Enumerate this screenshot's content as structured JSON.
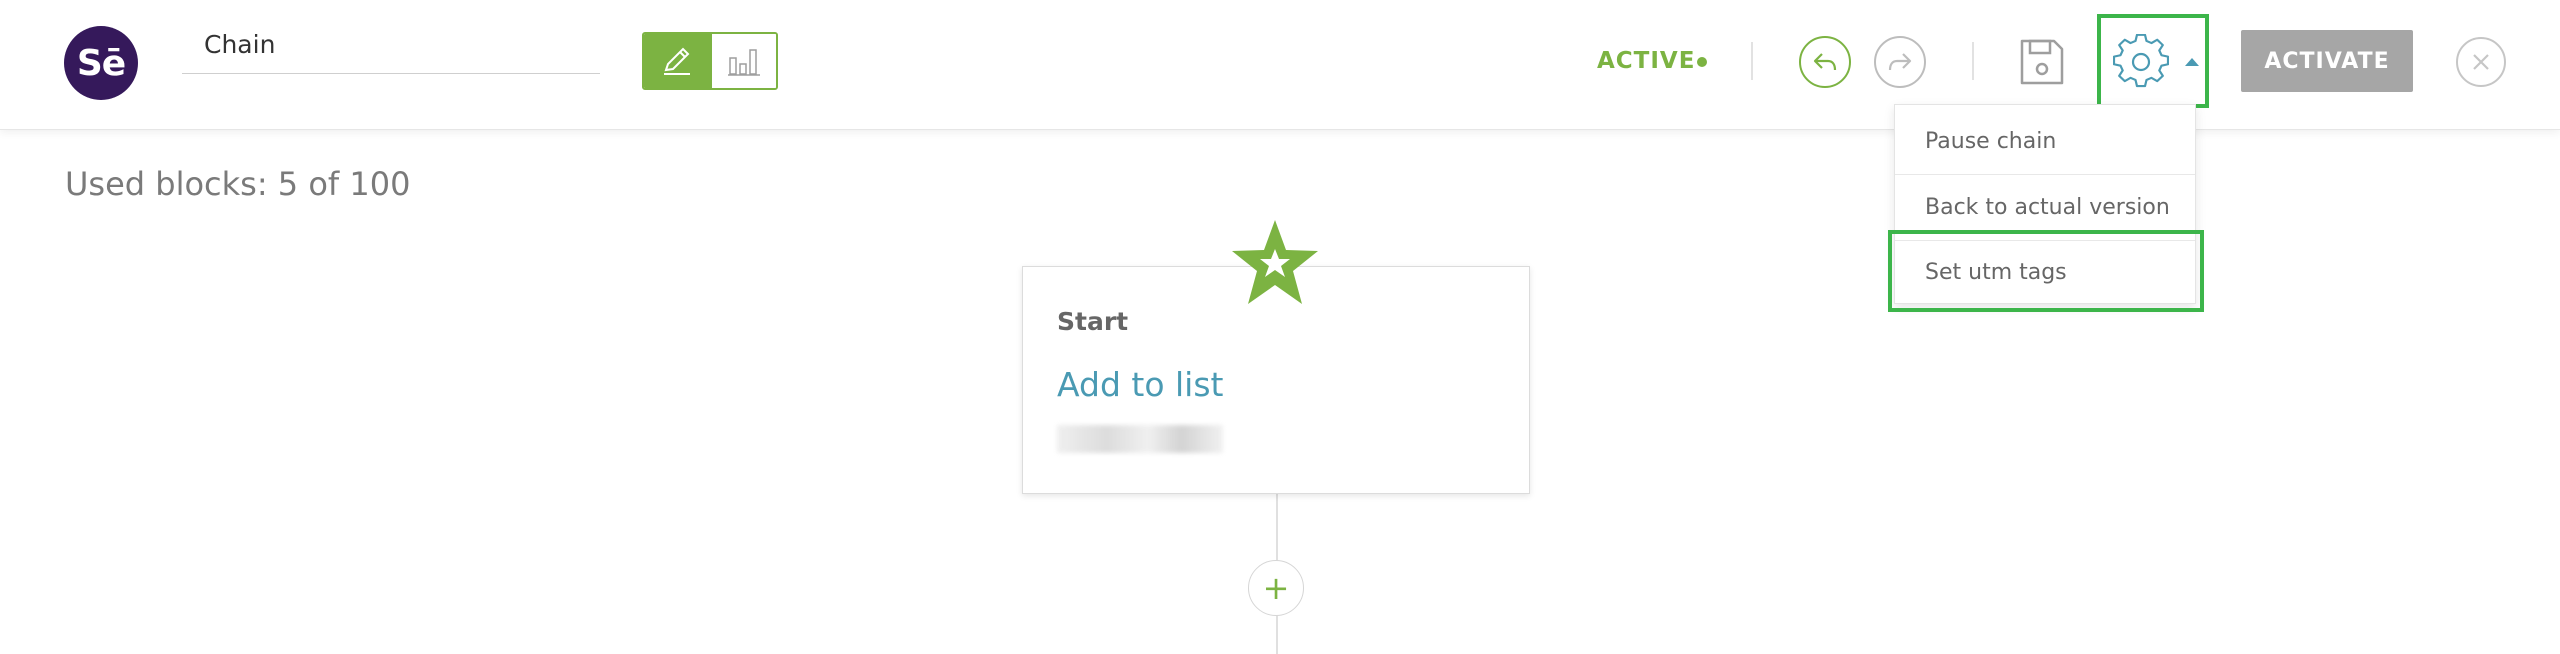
{
  "header": {
    "logo_text": "Sē",
    "chain_name": "Chain",
    "status": "ACTIVE",
    "activate_label": "ACTIVATE"
  },
  "used_blocks": "Used blocks: 5 of 100",
  "settings_menu": {
    "items": [
      {
        "label": "Pause chain"
      },
      {
        "label": "Back to actual version"
      },
      {
        "label": "Set utm tags"
      }
    ]
  },
  "start_block": {
    "title": "Start",
    "action": "Add to list"
  },
  "add_button_label": "+",
  "colors": {
    "brand_purple": "#35195b",
    "accent_green": "#7cb342",
    "link_blue": "#4a9ab3",
    "highlight_green": "#3cb54a",
    "button_gray": "#a6a6a6"
  },
  "icons": [
    "pencil-icon",
    "bar-chart-icon",
    "undo-icon",
    "redo-icon",
    "save-icon",
    "gear-icon",
    "caret-up-icon",
    "close-icon",
    "star-icon",
    "plus-icon"
  ]
}
